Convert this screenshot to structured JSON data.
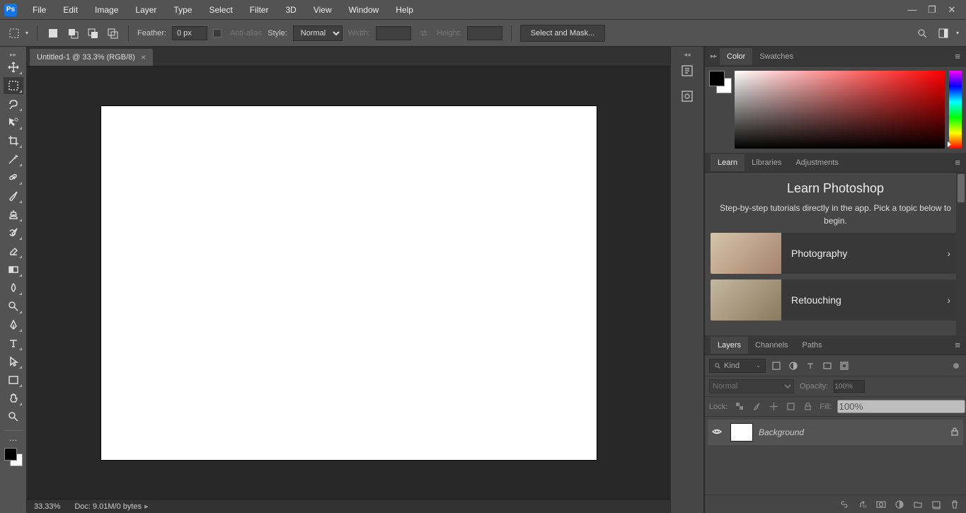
{
  "menubar": {
    "logo": "Ps",
    "items": [
      "File",
      "Edit",
      "Image",
      "Layer",
      "Type",
      "Select",
      "Filter",
      "3D",
      "View",
      "Window",
      "Help"
    ]
  },
  "optbar": {
    "feather_label": "Feather:",
    "feather_value": "0 px",
    "antialias_label": "Anti-alias",
    "style_label": "Style:",
    "style_value": "Normal",
    "width_label": "Width:",
    "width_value": "",
    "height_label": "Height:",
    "height_value": "",
    "select_mask": "Select and Mask..."
  },
  "doc": {
    "tab_title": "Untitled-1 @ 33.3% (RGB/8)"
  },
  "status": {
    "zoom": "33.33%",
    "doc_info": "Doc: 9.01M/0 bytes"
  },
  "panels": {
    "color": {
      "tabs": [
        "Color",
        "Swatches"
      ]
    },
    "learn": {
      "tabs": [
        "Learn",
        "Libraries",
        "Adjustments"
      ],
      "title": "Learn Photoshop",
      "desc": "Step-by-step tutorials directly in the app. Pick a topic below to begin.",
      "cards": [
        {
          "label": "Photography"
        },
        {
          "label": "Retouching"
        }
      ]
    },
    "layers": {
      "tabs": [
        "Layers",
        "Channels",
        "Paths"
      ],
      "filter_kind": "Kind",
      "blend_mode": "Normal",
      "opacity_label": "Opacity:",
      "opacity_value": "100%",
      "lock_label": "Lock:",
      "fill_label": "Fill:",
      "fill_value": "100%",
      "layer_name": "Background"
    }
  },
  "tools": [
    "move-tool",
    "marquee-tool",
    "lasso-tool",
    "quick-select-tool",
    "crop-tool",
    "eyedropper-tool",
    "spot-heal-tool",
    "brush-tool",
    "clone-stamp-tool",
    "history-brush-tool",
    "eraser-tool",
    "gradient-tool",
    "blur-tool",
    "dodge-tool",
    "pen-tool",
    "type-tool",
    "path-select-tool",
    "rectangle-tool",
    "hand-tool",
    "zoom-tool"
  ]
}
